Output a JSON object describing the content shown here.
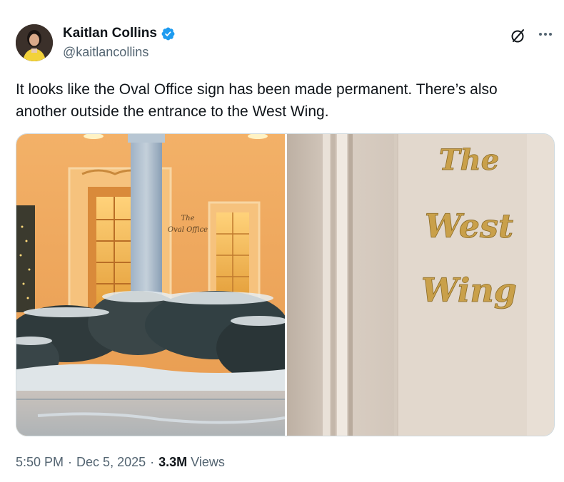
{
  "author": {
    "display_name": "Kaitlan Collins",
    "handle": "@kaitlancollins",
    "verified": true
  },
  "tweet": {
    "text": "It looks like the Oval Office sign has been made permanent. There’s also another outside the entrance to the West Wing."
  },
  "media": {
    "left_photo": {
      "sign_line1": "The",
      "sign_line2": "Oval Office"
    },
    "right_photo": {
      "sign_line1": "The",
      "sign_line2": "West",
      "sign_line3": "Wing"
    }
  },
  "meta": {
    "time": "5:50 PM",
    "separator": "·",
    "date": "Dec 5, 2025",
    "views_count": "3.3M",
    "views_label": "Views"
  },
  "colors": {
    "verified_blue": "#1d9bf0",
    "secondary_text": "#536471",
    "primary_text": "#0f1419"
  },
  "icons": {
    "verified": "verified-badge-icon",
    "grok": "grok-icon",
    "more": "more-icon"
  }
}
